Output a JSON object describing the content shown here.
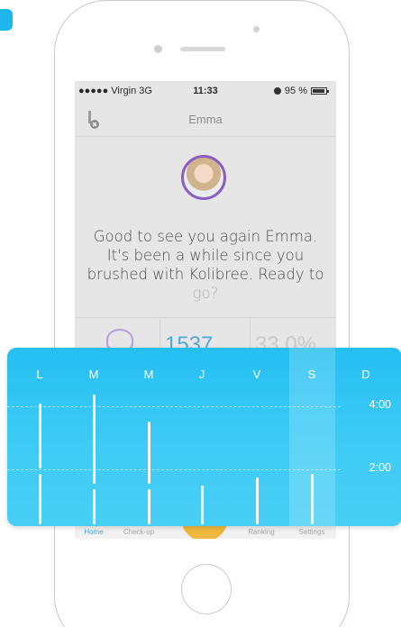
{
  "status": {
    "carrier": "●●●●● Virgin  3G",
    "time": "11:33",
    "battery": "95 %"
  },
  "nav": {
    "title": "Emma"
  },
  "greeting": "Good to see you again Emma.\nIt's been a while since you\nbrushed with Kolibree. Ready to\ngo?",
  "stats": {
    "score": "1537",
    "percent": "33.0%"
  },
  "tabs": [
    {
      "label": "Home",
      "icon": "home-icon",
      "active": true
    },
    {
      "label": "Check-up",
      "icon": "clipboard-icon",
      "active": false
    },
    {
      "label": "Ranking",
      "icon": "bars-icon",
      "active": false
    },
    {
      "label": "Settings",
      "icon": "sliders-icon",
      "active": false
    }
  ],
  "colors": {
    "accent": "#25bff2",
    "orange": "#f0b83c",
    "purple": "#8a5fbf",
    "active_tab": "#4fa7dd"
  },
  "chart_data": {
    "type": "bar",
    "categories": [
      "L",
      "M",
      "M",
      "J",
      "V",
      "S",
      "D"
    ],
    "y_tick_labels": [
      "4:00",
      "2:00"
    ],
    "highlighted_category_index": 5,
    "unit": "minutes",
    "ylim": [
      0,
      5
    ],
    "series": [
      {
        "values": [
          1.7,
          1.2,
          1.2,
          0,
          0,
          0,
          0
        ]
      },
      {
        "values": [
          2.2,
          3.0,
          2.1,
          1.3,
          1.6,
          1.7,
          0
        ]
      }
    ]
  }
}
